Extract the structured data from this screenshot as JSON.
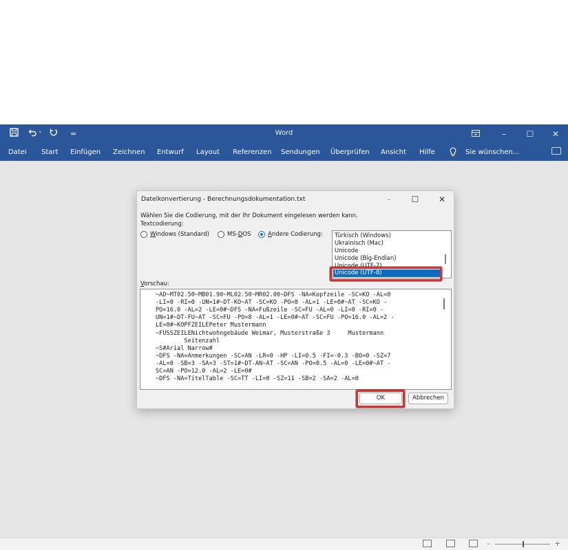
{
  "window": {
    "title": "Word",
    "minimize": "–",
    "maximize": "☐",
    "close": "✕",
    "ribbon_display_icon": "ribbon-display-options-icon"
  },
  "quick_access": {
    "save_icon": "save-icon",
    "undo_icon": "undo-icon",
    "undo_dropdown": "˅",
    "redo_icon": "redo-icon",
    "customize": "="
  },
  "ribbon": {
    "tabs": [
      "Datei",
      "Start",
      "Einfügen",
      "Zeichnen",
      "Entwurf",
      "Layout",
      "Referenzen",
      "Sendungen",
      "Überprüfen",
      "Ansicht",
      "Hilfe"
    ],
    "tell_me": "Sie wünschen...",
    "tell_me_icon": "lightbulb-icon",
    "comments_icon": "comments-icon"
  },
  "dialog": {
    "title": "Dateikonvertierung - Berechnungsdokumentation.txt",
    "instruction": "Wählen Sie die Codierung, mit der Ihr Dokument eingelesen werden kann.",
    "encoding_label": "Textcodierung:",
    "radios": [
      {
        "label_u": "W",
        "label_rest": "indows (Standard)",
        "selected": false
      },
      {
        "label_pre": "MS-",
        "label_u": "D",
        "label_rest": "OS",
        "selected": false
      },
      {
        "label_u": "A",
        "label_rest": "ndere Codierung:",
        "selected": true
      }
    ],
    "encodings": [
      "Türkisch (Windows)",
      "Ukrainisch (Mac)",
      "Unicode",
      "Unicode (Big-Endian)",
      "Unicode (UTF-7)",
      "Unicode (UTF-8)"
    ],
    "selected_encoding": "Unicode (UTF-8)",
    "preview_label_u": "V",
    "preview_label_rest": "orschau:",
    "preview_lines": [
      "~AD~MT02.50~MB01.90~ML02.50~MR02.00~DFS -NA=Kopfzeile -SC=KO -AL=0",
      "-LI=0 -RI=0 -UN=1#~DT-KO~AT -SC=KO -PO=8 -AL=1 -LE=0#~AT -SC=KO -",
      "PO=16.0 -AL=2 -LE=0#~DFS -NA=Fußzeile -SC=FU -AL=0 -LI=0 -RI=0 -",
      "UN=1#~DT-FU~AT -SC=FU -PO=8 -AL=1 -LE=0#~AT -SC=FU -PO=16.0 -AL=2 -",
      "LE=0#~KOPFZEILEPeter Mustermann",
      "~FUSSZEILENichtwohngebäude Weimar, Musterstraße 3     Mustermann",
      "        Seitenzahl",
      "~S#Arial Narrow#",
      "~DFS -NA=Anmerkungen -SC=AN -LR=0 -HP -LI=0.5 -FI=-0.3 -BO=0 -SZ=7",
      "-AL=0 -SB=3 -SA=3 -ST=1#~DT-AN~AT -SC=AN -PO=0.5 -AL=0 -LE=0#~AT -",
      "SC=AN -PO=12.0 -AL=2 -LE=0#",
      "~DFS -NA=TitelTable -SC=TT -LI=0 -SZ=11 -SB=2 -SA=2 -AL=0"
    ],
    "ok_label": "OK",
    "cancel_label": "Abbrechen",
    "minimize": "–",
    "maximize": "☐",
    "close": "✕"
  }
}
